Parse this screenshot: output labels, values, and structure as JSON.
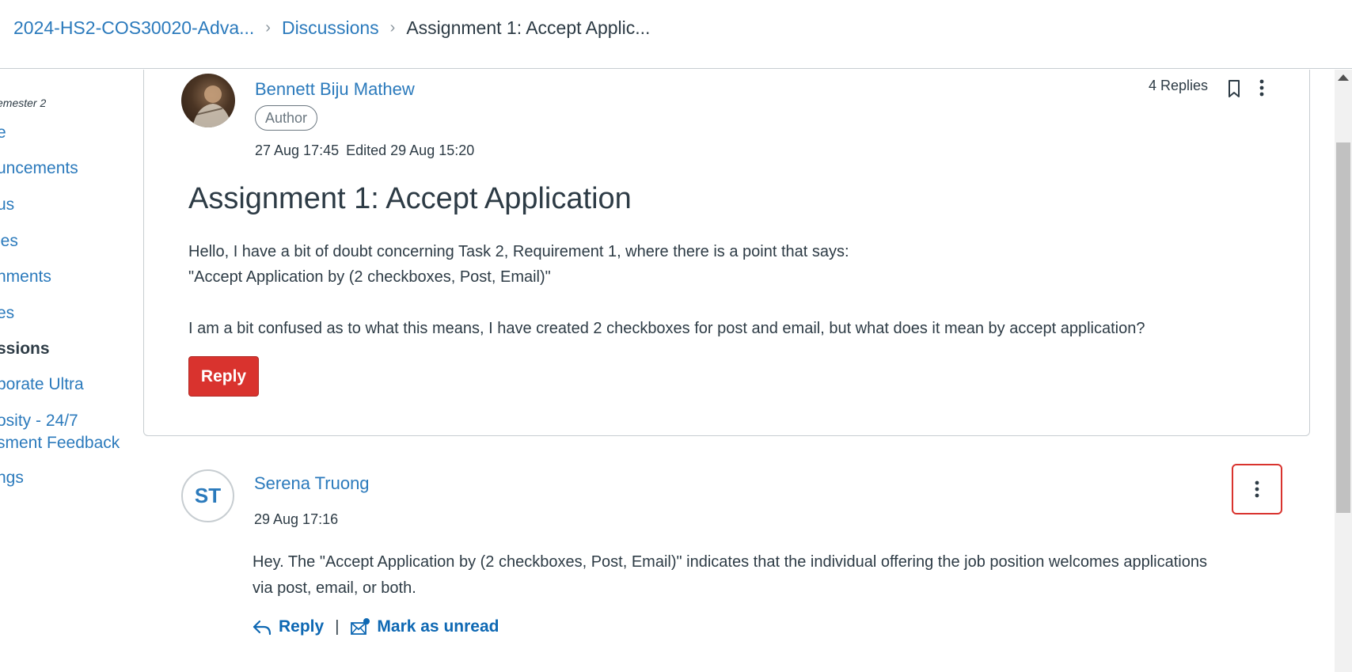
{
  "breadcrumb": {
    "course": "2024-HS2-COS30020-Adva...",
    "section": "Discussions",
    "current": "Assignment 1: Accept Applic..."
  },
  "leftnav": {
    "term": "emester 2",
    "items": [
      {
        "label": "e",
        "active": false
      },
      {
        "label": "uncements",
        "active": false
      },
      {
        "label": "us",
        "active": false
      },
      {
        "label": "les",
        "active": false
      },
      {
        "label": "nments",
        "active": false
      },
      {
        "label": "es",
        "active": false
      },
      {
        "label": "ssions",
        "active": true
      },
      {
        "label": "borate Ultra",
        "active": false
      },
      {
        "label": "osity - 24/7",
        "active": false
      },
      {
        "label": "sment Feedback",
        "active": false
      },
      {
        "label": "ngs",
        "active": false
      }
    ]
  },
  "topic": {
    "author": "Bennett Biju Mathew",
    "role": "Author",
    "posted": "27 Aug 17:45",
    "edited": "Edited 29 Aug 15:20",
    "replies": "4 Replies",
    "title": "Assignment 1: Accept Application",
    "body_line1": "Hello, I have a bit of doubt concerning Task 2, Requirement 1, where there is a point that says:",
    "body_line2": "\"Accept Application by (2 checkboxes, Post, Email)\"",
    "body_line3": "I am a bit confused as to what this means, I have created 2 checkboxes for post and email, but what does it mean by accept application?",
    "reply_button": "Reply"
  },
  "reply": {
    "initials": "ST",
    "author": "Serena Truong",
    "time": "29 Aug 17:16",
    "body_line1": "Hey. The \"Accept Application by (2 checkboxes, Post, Email)\" indicates that the individual offering the job position welcomes applications",
    "body_line2": "via post, email, or both.",
    "reply_label": "Reply",
    "separator": "|",
    "mark_unread_label": "Mark as unread"
  },
  "icons": {
    "bookmark": "bookmark-icon",
    "more": "kebab-menu-icon",
    "reply": "reply-arrow-icon",
    "unread": "mail-unread-icon"
  },
  "colors": {
    "link": "#2b7abc",
    "action": "#0e68b3",
    "danger": "#d9332e",
    "text": "#2d3b45"
  }
}
